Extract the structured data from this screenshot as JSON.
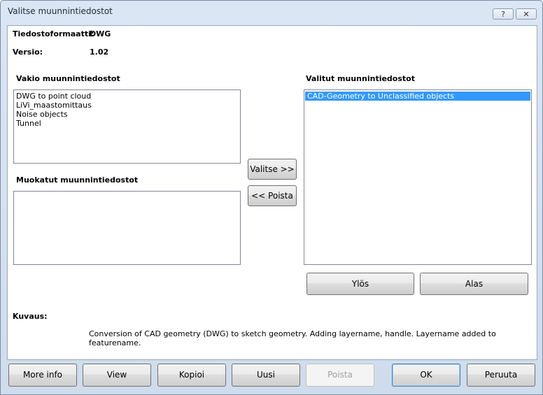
{
  "window": {
    "title": "Valitse muunnintiedostot",
    "help_glyph": "?",
    "close_glyph": "✕"
  },
  "info": {
    "format_label": "Tiedostoformaatti:",
    "format_value": "DWG",
    "version_label": "Versio:",
    "version_value": "1.02"
  },
  "standard": {
    "heading": "Vakio muunnintiedostot",
    "items": [
      "DWG to point cloud",
      "LiVi_maastomittaus",
      "Noise objects",
      "Tunnel"
    ]
  },
  "custom": {
    "heading": "Muokatut muunnintiedostot",
    "items": []
  },
  "selected": {
    "heading": "Valitut muunnintiedostot",
    "items": [
      "CAD-Geometry to Unclassified objects"
    ]
  },
  "middle_buttons": {
    "select": "Valitse >>",
    "remove": "<< Poista"
  },
  "order_buttons": {
    "up": "Ylös",
    "down": "Alas"
  },
  "description": {
    "label": "Kuvaus:",
    "text": "Conversion of CAD geometry (DWG) to sketch geometry. Adding layername, handle. Layername added to featurename."
  },
  "footer": {
    "more_info": "More info",
    "view": "View",
    "copy": "Kopioi",
    "new": "Uusi",
    "delete": "Poista",
    "ok": "OK",
    "cancel": "Peruuta"
  }
}
